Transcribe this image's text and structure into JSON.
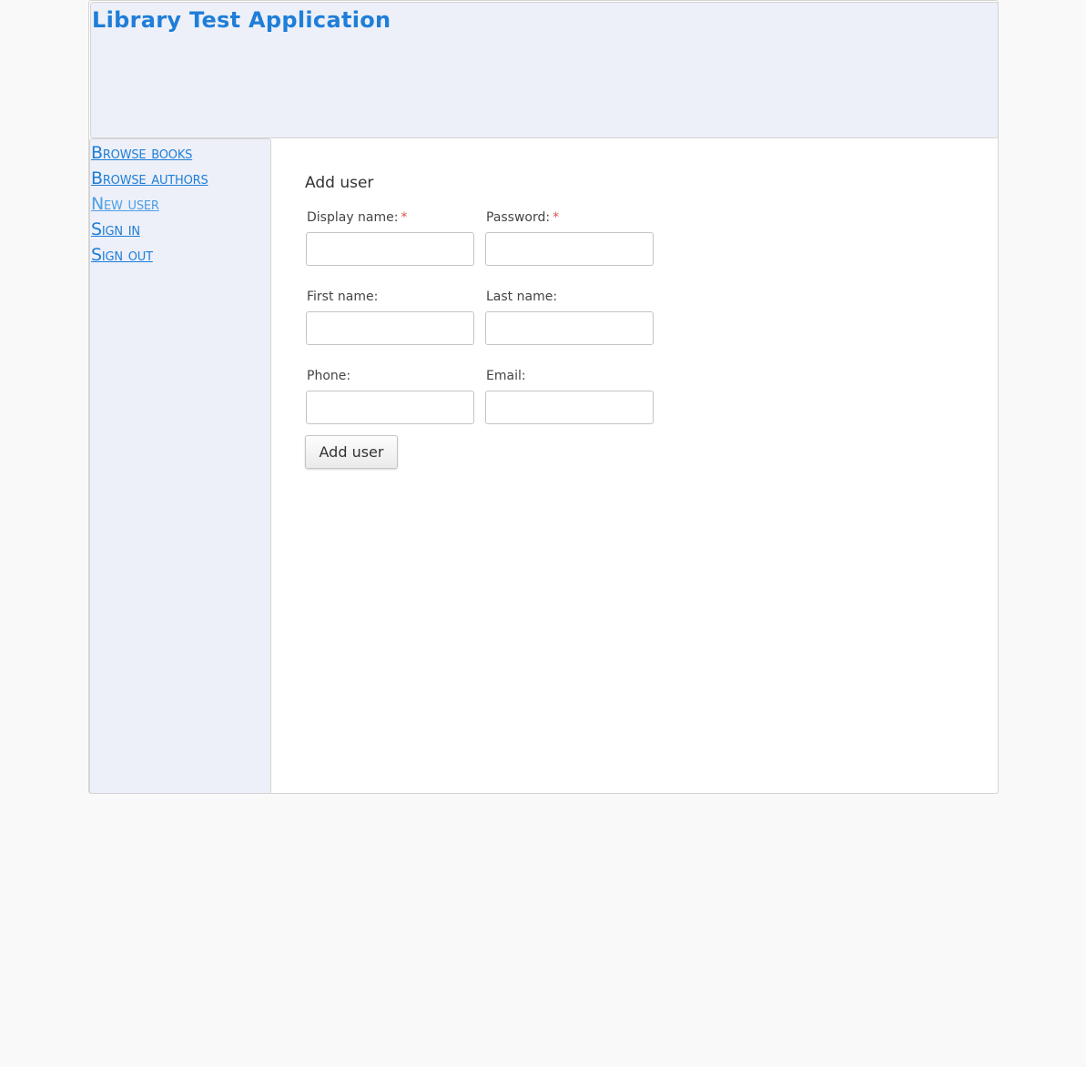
{
  "header": {
    "app_title": "Library Test Application"
  },
  "sidebar": {
    "items": [
      {
        "label": "Browse books",
        "current": false
      },
      {
        "label": "Browse authors",
        "current": false
      },
      {
        "label": "New user",
        "current": true
      },
      {
        "label": "Sign in",
        "current": false
      },
      {
        "label": "Sign out",
        "current": false
      }
    ]
  },
  "form": {
    "title": "Add user",
    "required_mark": "*",
    "fields": {
      "display_name": {
        "label": "Display name:",
        "value": ""
      },
      "password": {
        "label": "Password:",
        "value": ""
      },
      "first_name": {
        "label": "First name:",
        "value": ""
      },
      "last_name": {
        "label": "Last name:",
        "value": ""
      },
      "phone": {
        "label": "Phone:",
        "value": ""
      },
      "email": {
        "label": "Email:",
        "value": ""
      }
    },
    "submit_label": "Add user"
  },
  "colors": {
    "accent": "#1e7ed8",
    "panel_bg": "#edf0f8",
    "required": "#d9534f"
  }
}
